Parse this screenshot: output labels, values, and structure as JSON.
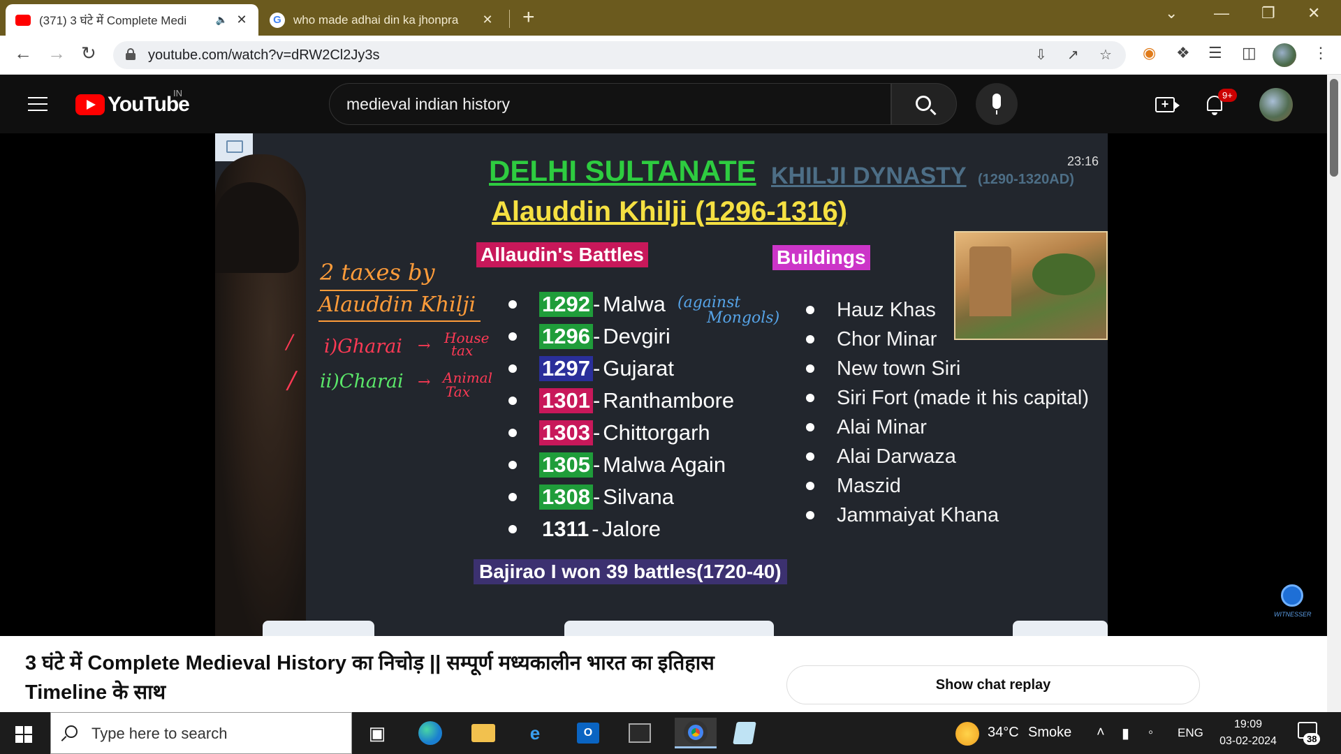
{
  "browser": {
    "tabs": [
      {
        "title": "(371) 3 घंटे में Complete Medi",
        "active": true,
        "favicon": "youtube-favicon"
      },
      {
        "title": "who made adhai din ka jhonpra",
        "active": false,
        "favicon": "google-favicon"
      }
    ],
    "new_tab_label": "+",
    "url": "youtube.com/watch?v=dRW2Cl2Jy3s"
  },
  "youtube": {
    "logo_text": "YouTube",
    "country": "IN",
    "search_value": "medieval indian history",
    "notification_count": "9+"
  },
  "slide": {
    "title": "DELHI SULTANATE",
    "subtitle": "KHILJI DYNASTY",
    "subtitle_years": "(1290-1320AD)",
    "timestamp": "23:16",
    "ruler": "Alauddin Khilji (1296-1316)",
    "battles_label": "Allaudin's Battles",
    "buildings_label": "Buildings",
    "battles": [
      {
        "year": "1292",
        "place": "Malwa",
        "color": "#1f9d3a"
      },
      {
        "year": "1296",
        "place": "Devgiri",
        "color": "#1f9d3a"
      },
      {
        "year": "1297",
        "place": "Gujarat",
        "color": "#2a2f9a"
      },
      {
        "year": "1301",
        "place": "Ranthambore",
        "color": "#c8185a"
      },
      {
        "year": "1303",
        "place": "Chittorgarh",
        "color": "#c8185a"
      },
      {
        "year": "1305",
        "place": "Malwa Again",
        "color": "#1f9d3a"
      },
      {
        "year": "1308",
        "place": "Silvana",
        "color": "#1f9d3a"
      },
      {
        "year": "1311",
        "place": " Jalore",
        "color": "transparent"
      }
    ],
    "malwa_note_line1": "(against",
    "malwa_note_line2": "Mongols)",
    "buildings": [
      "Hauz Khas",
      "Chor Minar",
      "New town Siri",
      "Siri Fort (made it his capital)",
      "Alai Minar",
      "Alai Darwaza",
      "Maszid",
      "Jammaiyat Khana"
    ],
    "handwritten": {
      "heading_line1": "2 taxes by",
      "heading_line2": "Alauddin Khilji",
      "tax1": "i)Gharai",
      "tax1_meaning_line1": "House",
      "tax1_meaning_line2": "tax",
      "tax2": "ii)Charai",
      "tax2_meaning_line1": "Animal",
      "tax2_meaning_line2": "Tax"
    },
    "bottom_note": "Bajirao I won 39 battles(1720-40)",
    "watermark": "WITNESSER"
  },
  "video": {
    "title": "3 घंटे में Complete Medieval History का निचोड़ || सम्पूर्ण मध्यकालीन भारत का इतिहास Timeline के साथ",
    "chat_replay_label": "Show chat replay"
  },
  "taskbar": {
    "search_placeholder": "Type here to search",
    "weather_temp": "34°C",
    "weather_desc": "Smoke",
    "language": "ENG",
    "time": "19:09",
    "date": "03-02-2024",
    "notification_count": "38"
  }
}
